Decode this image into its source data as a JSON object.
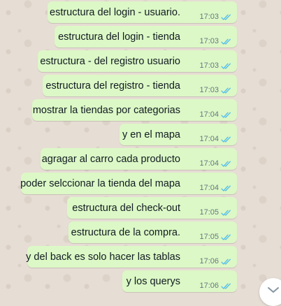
{
  "messages": [
    {
      "text": "estructura del login - usuario.",
      "time": "17:03",
      "status": "read"
    },
    {
      "text": "estructura del login - tienda",
      "time": "17:03",
      "status": "read"
    },
    {
      "text": "estructura - del registro usuario",
      "time": "17:03",
      "status": "read"
    },
    {
      "text": "estructura del registro - tienda",
      "time": "17:03",
      "status": "read"
    },
    {
      "text": "mostrar la tiendas por categorias",
      "time": "17:04",
      "status": "read"
    },
    {
      "text": "y en el mapa",
      "time": "17:04",
      "status": "read"
    },
    {
      "text": "agragar al carro cada producto",
      "time": "17:04",
      "status": "read"
    },
    {
      "text": "poder selccionar la tienda del mapa",
      "time": "17:04",
      "status": "read"
    },
    {
      "text": "estructura del check-out",
      "time": "17:05",
      "status": "read"
    },
    {
      "text": "estructura de la compra.",
      "time": "17:05",
      "status": "read"
    },
    {
      "text": "y del back es solo hacer las tablas",
      "time": "17:06",
      "status": "read"
    },
    {
      "text": "y los querys",
      "time": "17:06",
      "status": "read"
    }
  ],
  "icons": {
    "read_receipt": "double-check-icon",
    "scroll_down": "chevron-down-icon"
  },
  "colors": {
    "outgoing_bubble": "#dcf8c6",
    "chat_background": "#e6ddd4",
    "read_ticks": "#53bdeb",
    "timestamp": "#667781",
    "message_text": "#111b21"
  }
}
